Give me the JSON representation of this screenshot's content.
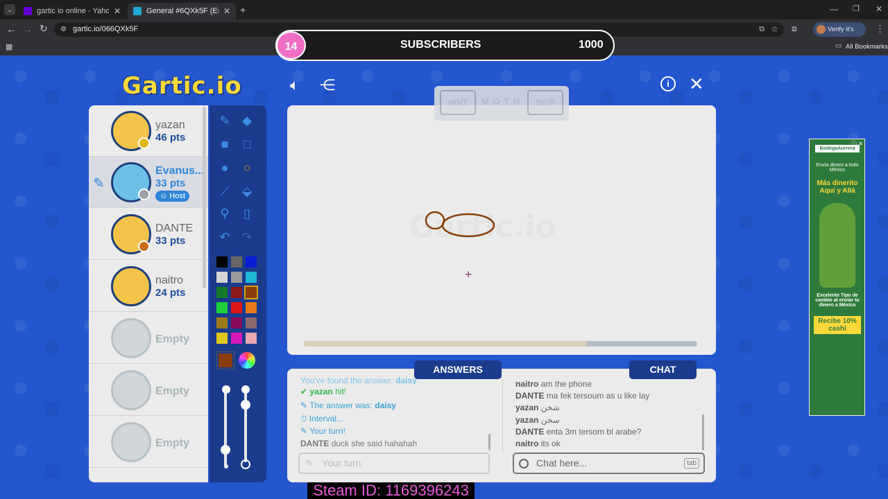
{
  "tabs": [
    {
      "title": "gartic io online - Yahoo Search",
      "active": false
    },
    {
      "title": "General #6QXk5F (English) - Ga",
      "active": true
    }
  ],
  "address": {
    "url": "gartic.io/066QXk5F"
  },
  "profile": {
    "verify_label": "Verify it's you"
  },
  "bookmarks": {
    "all_label": "All Bookmarks"
  },
  "subscribers": {
    "current": "14",
    "label": "SUBSCRIBERS",
    "goal": "1000"
  },
  "logo": {
    "text": "Gartic.io"
  },
  "hint_bar": {
    "hint_label": "HINT",
    "word": "M O T H",
    "skip_label": "SKIP"
  },
  "players": [
    {
      "name": "yazan",
      "pts": "46 pts",
      "badge_color": "#e3b516"
    },
    {
      "name": "Evanus...",
      "pts": "33 pts",
      "host_label": "Host",
      "badge_color": "#9aa0a6",
      "drawing": true
    },
    {
      "name": "DANTE",
      "pts": "33 pts",
      "badge_color": "#c86f16"
    },
    {
      "name": "naitro",
      "pts": "24 pts"
    },
    {
      "name": "Empty"
    },
    {
      "name": "Empty"
    },
    {
      "name": "Empty"
    }
  ],
  "palette": [
    "#000000",
    "#666666",
    "#0a1fd4",
    "#d6d6d6",
    "#9a9a9a",
    "#1fb6d6",
    "#167a2c",
    "#8c1a1a",
    "#8a3f0a",
    "#1fcf3c",
    "#e01818",
    "#e87818",
    "#a07a1a",
    "#8a0a5a",
    "#8a6a6a",
    "#e0c81a",
    "#d61ab8",
    "#e8a8b0"
  ],
  "current_color": "#8a3f0a",
  "drawing_progress": 0.72,
  "answers": {
    "header": "ANSWERS",
    "messages": [
      {
        "icon": "",
        "text": "You've found the answer:",
        "bold": "daisy"
      },
      {
        "icon": "✔",
        "user": "yazan",
        "text": "hit!"
      },
      {
        "icon": "✎",
        "text": "The answer was:",
        "bold": "daisy"
      },
      {
        "icon": "⏱",
        "text": "Interval..."
      },
      {
        "icon": "✎",
        "text": "Your turn!"
      },
      {
        "user": "DANTE",
        "text": "duck she said hahahah"
      }
    ],
    "placeholder": "Your turn"
  },
  "chat": {
    "header": "CHAT",
    "messages": [
      {
        "user": "naitro",
        "text": "am the phone"
      },
      {
        "user": "DANTE",
        "text": "ma fek tersoum as u like lay"
      },
      {
        "user": "yazan",
        "text": "شخن"
      },
      {
        "user": "yazan",
        "text": "سخن"
      },
      {
        "user": "DANTE",
        "text": "enta 3m tersom bl arabe?"
      },
      {
        "user": "naitro",
        "text": "its ok"
      }
    ],
    "placeholder": "Chat here...",
    "tab_hint": "tab"
  },
  "ad": {
    "brand": "BodegaAurrera",
    "line1": "Envía dinero a todo México",
    "line2": "Más dinerito Aquí y Allá",
    "line3": "Excelente Tipo de cambio al enviar tu dinero a México",
    "line4": "Recibe 10% cashi"
  },
  "steam": {
    "text": "Steam ID: 1169396243"
  }
}
